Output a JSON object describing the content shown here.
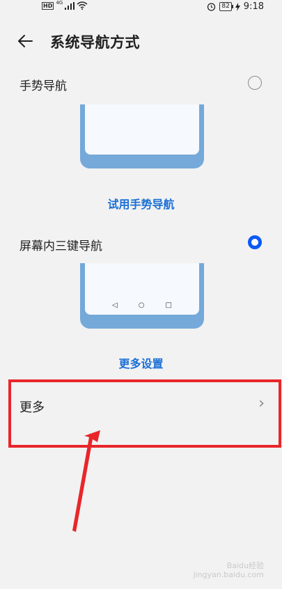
{
  "status_bar": {
    "hd_label": "HD",
    "network_label": "4G",
    "battery_level": "82",
    "time": "9:18"
  },
  "header": {
    "title": "系统导航方式"
  },
  "options": {
    "gesture": {
      "label": "手势导航",
      "selected": false,
      "try_link": "试用手势导航"
    },
    "three_key": {
      "label": "屏幕内三键导航",
      "selected": true,
      "settings_link": "更多设置"
    }
  },
  "more": {
    "label": "更多"
  },
  "watermark": {
    "line1": "Baidu经验",
    "line2": "jingyan.baidu.com"
  },
  "colors": {
    "accent": "#0a59f7",
    "link": "#1a6fd6",
    "highlight": "#e8262a",
    "phone_frame": "#74a9d9"
  }
}
